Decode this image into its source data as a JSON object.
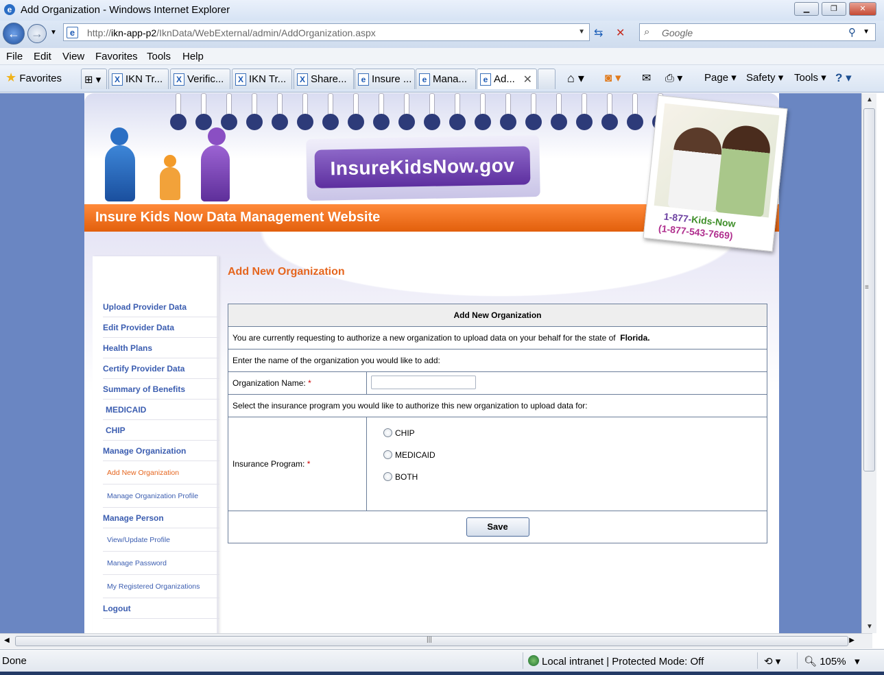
{
  "window": {
    "title": "Add Organization - Windows Internet Explorer"
  },
  "address_bar": {
    "url_prefix": "http://",
    "url_host": "ikn-app-p2",
    "url_path": "/IknData/WebExternal/admin/AddOrganization.aspx",
    "search_placeholder": "Google"
  },
  "menu": [
    "File",
    "Edit",
    "View",
    "Favorites",
    "Tools",
    "Help"
  ],
  "favorites_label": "Favorites",
  "tabs": [
    {
      "label": "IKN Tr...",
      "icon": "ikn-icon"
    },
    {
      "label": "Verific...",
      "icon": "ikn-icon"
    },
    {
      "label": "IKN Tr...",
      "icon": "ikn-icon"
    },
    {
      "label": "Share...",
      "icon": "ikn-icon"
    },
    {
      "label": "Insure ...",
      "icon": "ie-icon"
    },
    {
      "label": "Mana...",
      "icon": "ie-icon"
    },
    {
      "label": "Ad...",
      "icon": "ie-icon",
      "active": true
    }
  ],
  "command_bar": {
    "page": "Page",
    "safety": "Safety",
    "tools": "Tools"
  },
  "site": {
    "brand": "InsureKidsNow.gov",
    "banner_title": "Insure Kids Now Data Management Website",
    "phone_1": "1-877-",
    "phone_1b": "Kids-Now",
    "phone_2": "(1-877-543-7669)"
  },
  "sidebar": {
    "items": [
      {
        "label": "Upload Provider Data",
        "style": "main"
      },
      {
        "label": "Edit Provider Data",
        "style": "main"
      },
      {
        "label": "Health Plans",
        "style": "main"
      },
      {
        "label": "Certify Provider Data",
        "style": "main"
      },
      {
        "label": "Summary of Benefits",
        "style": "main"
      },
      {
        "label": "MEDICAID",
        "style": "sub"
      },
      {
        "label": "CHIP",
        "style": "sub"
      },
      {
        "label": "Manage Organization",
        "style": "main"
      },
      {
        "label": "Add New Organization",
        "style": "small-current"
      },
      {
        "label": "Manage Organization Profile",
        "style": "small"
      },
      {
        "label": "Manage Person",
        "style": "main"
      },
      {
        "label": "View/Update Profile",
        "style": "small"
      },
      {
        "label": "Manage Password",
        "style": "small"
      },
      {
        "label": "My Registered Organizations",
        "style": "small"
      },
      {
        "label": "Logout",
        "style": "main"
      }
    ]
  },
  "form": {
    "page_heading": "Add New Organization",
    "table_heading": "Add New Organization",
    "intro_text": "You are currently requesting to authorize a new organization to upload data on your behalf for the state of",
    "state": "Florida.",
    "name_prompt": "Enter the name of the organization you would like to add:",
    "name_label": "Organization Name:",
    "required_mark": "*",
    "name_value": "",
    "program_prompt": "Select the insurance program you would like to authorize this new organization to upload data for:",
    "program_label": "Insurance Program:",
    "program_options": [
      "CHIP",
      "MEDICAID",
      "BOTH"
    ],
    "save_label": "Save"
  },
  "status_bar": {
    "status": "Done",
    "zone": "Local intranet | Protected Mode: Off",
    "zoom": "105%"
  },
  "colors": {
    "accent_orange": "#e5651e",
    "nav_blue": "#3b5db0",
    "page_bg": "#6a86c2"
  }
}
